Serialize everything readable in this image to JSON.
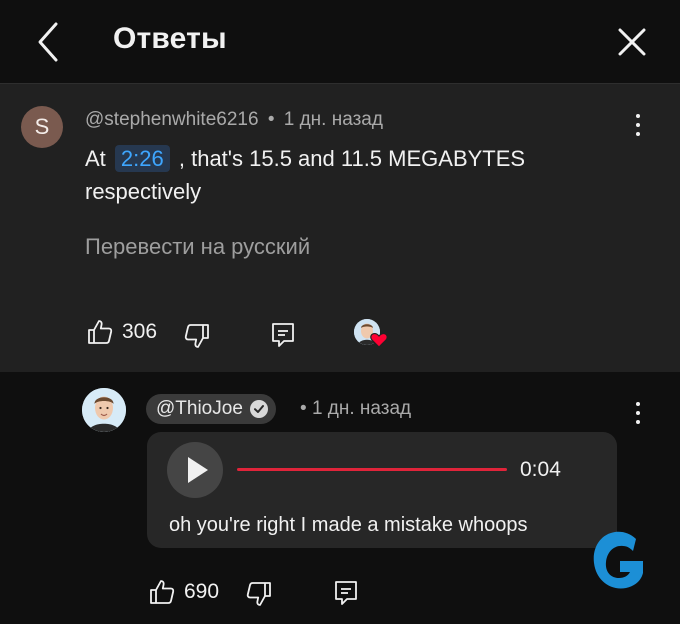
{
  "header": {
    "title": "Ответы"
  },
  "comment": {
    "avatar_letter": "S",
    "author": "@stephenwhite6216",
    "separator": "•",
    "time": "1 дн. назад",
    "text_before": "At",
    "timestamp": "2:26",
    "text_after": ", that's 15.5 and 11.5 MEGABYTES respectively",
    "translate_label": "Перевести на русский",
    "likes": "306"
  },
  "reply": {
    "author": "@ThioJoe",
    "separator": "•",
    "time": "1 дн. назад",
    "voice_duration": "0:04",
    "voice_progress": 0,
    "transcript": "oh you're right I made a mistake whoops",
    "likes": "690"
  },
  "colors": {
    "accent_link": "#3ea6ff",
    "progress_red": "#e0243a",
    "heart": "#ff0033",
    "logo_blue": "#1c8fd6"
  },
  "icons": [
    "back-icon",
    "close-icon",
    "kebab-icon",
    "thumbs-up-icon",
    "thumbs-down-icon",
    "reply-icon",
    "heart-icon",
    "verified-check-icon",
    "play-icon"
  ]
}
